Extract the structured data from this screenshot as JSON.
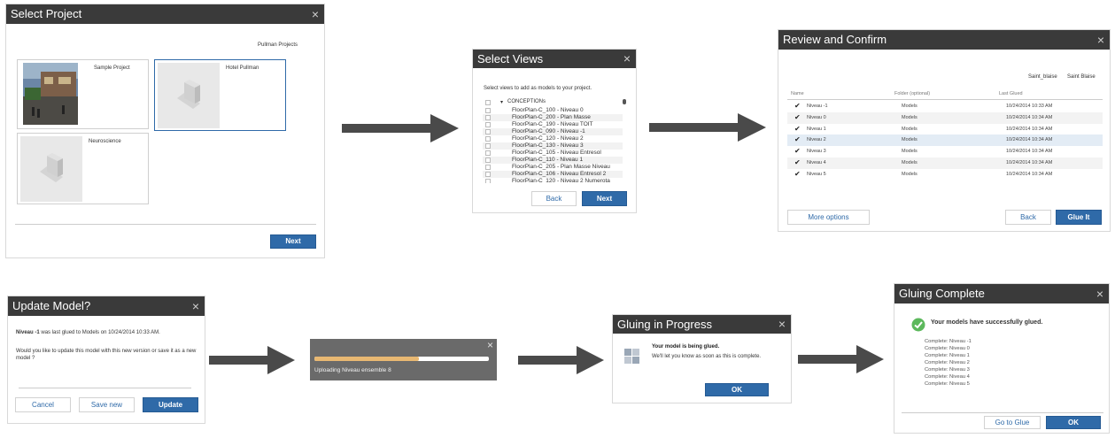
{
  "select_project": {
    "title": "Select Project",
    "hub_name": "Pullman Projects",
    "projects": [
      "Sample Project",
      "Hotel Pullman",
      "Neuroscience"
    ],
    "next_label": "Next"
  },
  "select_views": {
    "title": "Select Views",
    "instruction": "Select views to add as models to your project.",
    "folder": "CONCEPTIONs",
    "views": [
      "FloorPlan-C_100 - Niveau 0",
      "FloorPlan-C_200 - Plan Masse",
      "FloorPlan-C_190 - Niveau TOIT",
      "FloorPlan-C_090 - Niveau -1",
      "FloorPlan-C_120 - Niveau 2",
      "FloorPlan-C_130 - Niveau 3",
      "FloorPlan-C_105 - Niveau Entresol",
      "FloorPlan-C_110 - Niveau 1",
      "FloorPlan-C_205 - Plan Masse Niveau",
      "FloorPlan-C_106 - Niveau Entresol 2",
      "FloorPlan-C_120 - Niveau 2 Numerota"
    ],
    "back_label": "Back",
    "next_label": "Next"
  },
  "review": {
    "title": "Review and Confirm",
    "project": "Saint_blaise",
    "hub": "Saint Blaise",
    "columns": [
      "Name",
      "Folder (optional)",
      "Last Glued"
    ],
    "rows": [
      {
        "name": "Niveau -1",
        "folder": "Models",
        "date": "10/24/2014 10:33 AM"
      },
      {
        "name": "Niveau 0",
        "folder": "Models",
        "date": "10/24/2014 10:34 AM"
      },
      {
        "name": "Niveau 1",
        "folder": "Models",
        "date": "10/24/2014 10:34 AM"
      },
      {
        "name": "Niveau 2",
        "folder": "Models",
        "date": "10/24/2014 10:34 AM"
      },
      {
        "name": "Niveau 3",
        "folder": "Models",
        "date": "10/24/2014 10:34 AM"
      },
      {
        "name": "Niveau 4",
        "folder": "Models",
        "date": "10/24/2014 10:34 AM"
      },
      {
        "name": "Niveau 5",
        "folder": "Models",
        "date": "10/24/2014 10:34 AM"
      }
    ],
    "more_options_label": "More options",
    "back_label": "Back",
    "glue_label": "Glue It"
  },
  "update_model": {
    "title": "Update Model?",
    "model_name": "Niveau -1",
    "line1": "was last glued to Models on 10/24/2014 10:33 AM.",
    "line2": "Would you like to update this model with this new version or save it as a new model ?",
    "cancel_label": "Cancel",
    "save_new_label": "Save new",
    "update_label": "Update"
  },
  "upload": {
    "status": "Uploading Niveau ensemble 8",
    "progress": 0.6
  },
  "gluing_progress": {
    "title": "Gluing in Progress",
    "heading": "Your model is being glued.",
    "message": "We'll let you know as soon as this is complete.",
    "ok_label": "OK"
  },
  "gluing_complete": {
    "title": "Gluing Complete",
    "heading": "Your models have successfully glued.",
    "items": [
      "Complete: Niveau -1",
      "Complete: Niveau 0",
      "Complete: Niveau 1",
      "Complete: Niveau 2",
      "Complete: Niveau 3",
      "Complete: Niveau 4",
      "Complete: Niveau 5"
    ],
    "go_label": "Go to Glue",
    "ok_label": "OK"
  },
  "icons": {
    "close": "×",
    "check": "✔",
    "caret": "▾"
  },
  "colors": {
    "title_bar": "#3a3a3a",
    "primary": "#2f6aa8",
    "success": "#5cb85c",
    "arrow": "#4a4a4a",
    "progress": "#e8b872"
  }
}
